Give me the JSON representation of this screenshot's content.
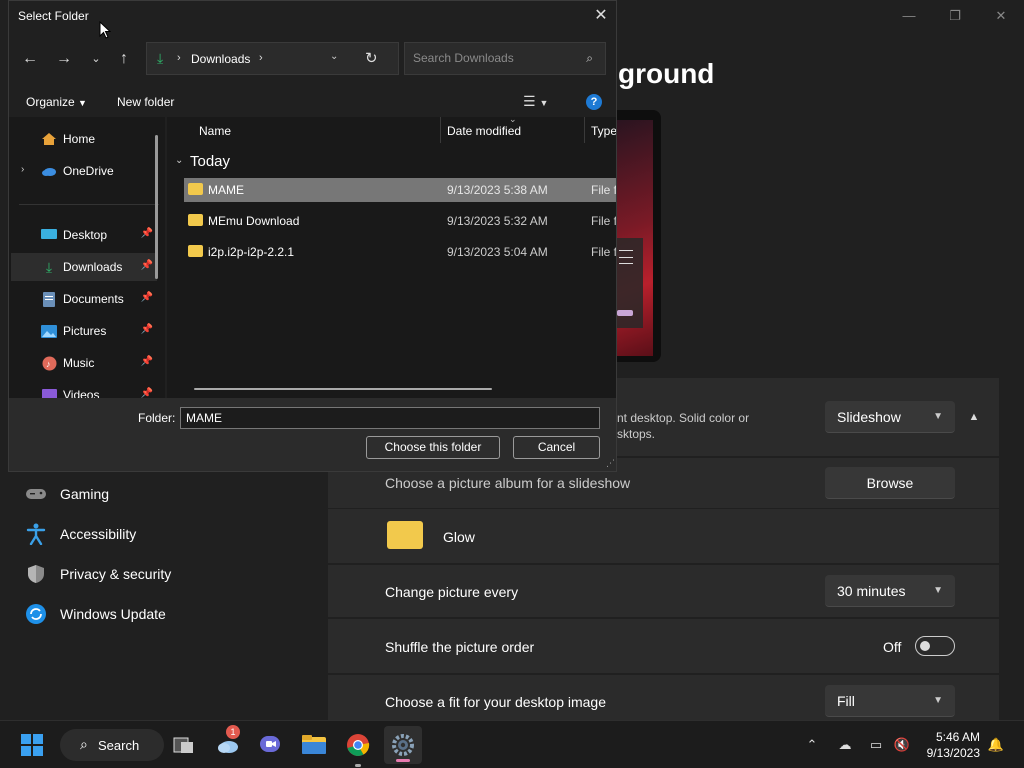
{
  "settings": {
    "heading": "ground",
    "window_controls": {
      "minimize": "—",
      "maximize": "❐",
      "close": "✕"
    },
    "background_row": {
      "desc_line1": "nt desktop. Solid color or",
      "desc_line2": "sktops.",
      "value": "Slideshow"
    },
    "album_row": {
      "label": "Choose a picture album for a slideshow",
      "button": "Browse"
    },
    "album_folder": {
      "name": "Glow"
    },
    "interval_row": {
      "label": "Change picture every",
      "value": "30 minutes"
    },
    "shuffle_row": {
      "label": "Shuffle the picture order",
      "state": "Off"
    },
    "fit_row": {
      "label": "Choose a fit for your desktop image",
      "value": "Fill"
    },
    "nav": [
      {
        "label": "Gaming",
        "icon": "gamepad-icon"
      },
      {
        "label": "Accessibility",
        "icon": "accessibility-icon"
      },
      {
        "label": "Privacy & security",
        "icon": "shield-icon"
      },
      {
        "label": "Windows Update",
        "icon": "update-icon"
      }
    ]
  },
  "dialog": {
    "title": "Select Folder",
    "close": "✕",
    "address": {
      "path": "Downloads"
    },
    "search_placeholder": "Search Downloads",
    "commands": {
      "organize": "Organize",
      "new_folder": "New folder"
    },
    "nav_pane": [
      {
        "label": "Home",
        "icon": "home-icon",
        "pinned": false
      },
      {
        "label": "OneDrive",
        "icon": "onedrive-icon",
        "pinned": false
      },
      {
        "label": "Desktop",
        "icon": "desktop-icon",
        "pinned": true
      },
      {
        "label": "Downloads",
        "icon": "download-icon",
        "pinned": true,
        "selected": true
      },
      {
        "label": "Documents",
        "icon": "documents-icon",
        "pinned": true
      },
      {
        "label": "Pictures",
        "icon": "pictures-icon",
        "pinned": true
      },
      {
        "label": "Music",
        "icon": "music-icon",
        "pinned": true
      },
      {
        "label": "Videos",
        "icon": "videos-icon",
        "pinned": true
      }
    ],
    "columns": [
      "Name",
      "Date modified",
      "Type"
    ],
    "group": "Today",
    "files": [
      {
        "name": "MAME",
        "date": "9/13/2023 5:38 AM",
        "type": "File fo",
        "selected": true
      },
      {
        "name": "MEmu Download",
        "date": "9/13/2023 5:32 AM",
        "type": "File fo"
      },
      {
        "name": "i2p.i2p-i2p-2.2.1",
        "date": "9/13/2023 5:04 AM",
        "type": "File fo"
      }
    ],
    "folder_label": "Folder:",
    "folder_value": "MAME",
    "choose_button": "Choose this folder",
    "cancel_button": "Cancel"
  },
  "taskbar": {
    "search_label": "Search",
    "notification_badge": "1",
    "time": "5:46 AM",
    "date": "9/13/2023"
  },
  "colors": {
    "accent": "#0078d4",
    "folder": "#f2c94c"
  }
}
